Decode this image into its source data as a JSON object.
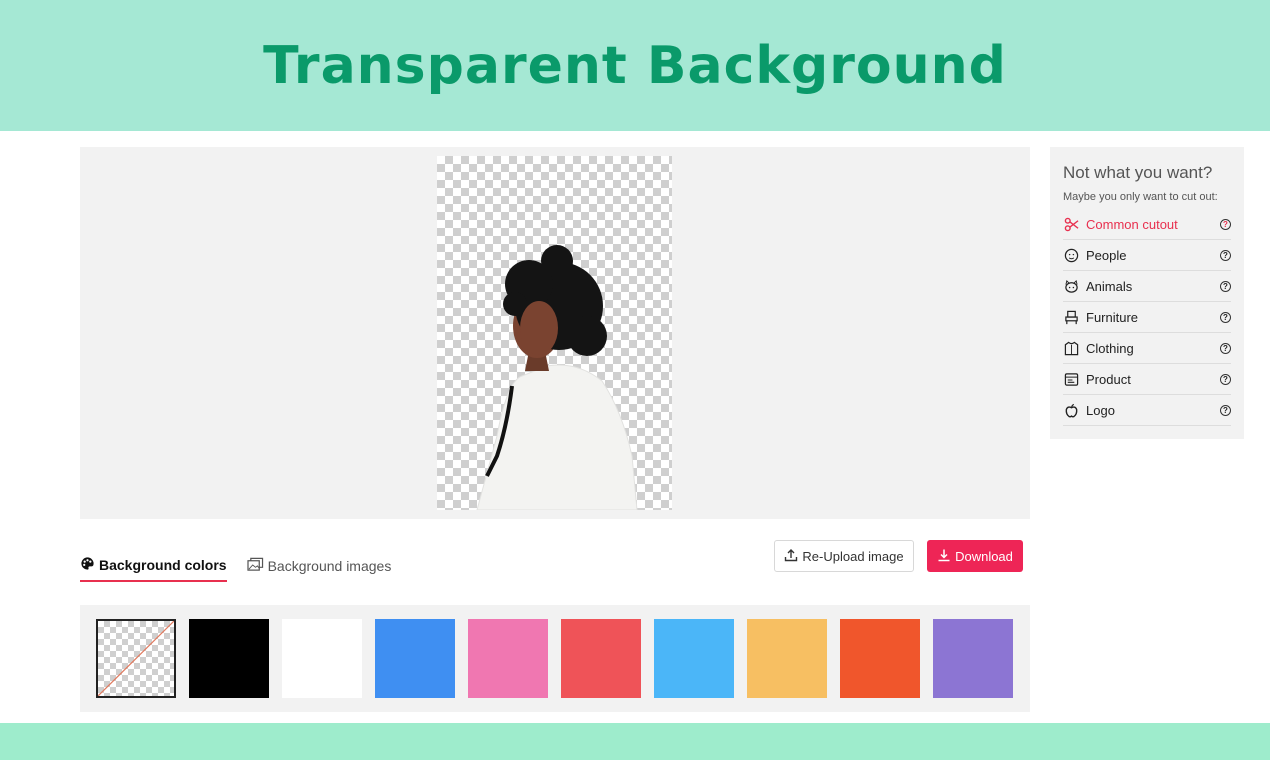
{
  "banner": {
    "title": "Transparent Background"
  },
  "sidebar": {
    "title": "Not what you want?",
    "subtitle": "Maybe you only want to cut out:",
    "items": [
      {
        "label": "Common cutout",
        "icon": "scissors-icon",
        "active": true
      },
      {
        "label": "People",
        "icon": "people-icon"
      },
      {
        "label": "Animals",
        "icon": "animal-icon"
      },
      {
        "label": "Furniture",
        "icon": "furniture-icon"
      },
      {
        "label": "Clothing",
        "icon": "clothing-icon"
      },
      {
        "label": "Product",
        "icon": "product-icon"
      },
      {
        "label": "Logo",
        "icon": "logo-icon"
      }
    ],
    "help_glyph": "?"
  },
  "tabs": [
    {
      "label": "Background colors",
      "icon": "palette-icon",
      "active": true
    },
    {
      "label": "Background images",
      "icon": "images-icon",
      "active": false
    }
  ],
  "actions": {
    "reupload_label": "Re-Upload image",
    "download_label": "Download"
  },
  "swatches": [
    {
      "color": "transparent",
      "selected": true
    },
    {
      "color": "#000000"
    },
    {
      "color": "#ffffff"
    },
    {
      "color": "#3f8ff2"
    },
    {
      "color": "#f077b1"
    },
    {
      "color": "#ef5358"
    },
    {
      "color": "#4bb6f8"
    },
    {
      "color": "#f7bf62"
    },
    {
      "color": "#f0562c"
    },
    {
      "color": "#8c75d3"
    }
  ],
  "colors": {
    "accent": "#e8304f",
    "download": "#ee2556",
    "banner_bg": "#a5e8d4",
    "banner_text": "#0a9a6a"
  }
}
